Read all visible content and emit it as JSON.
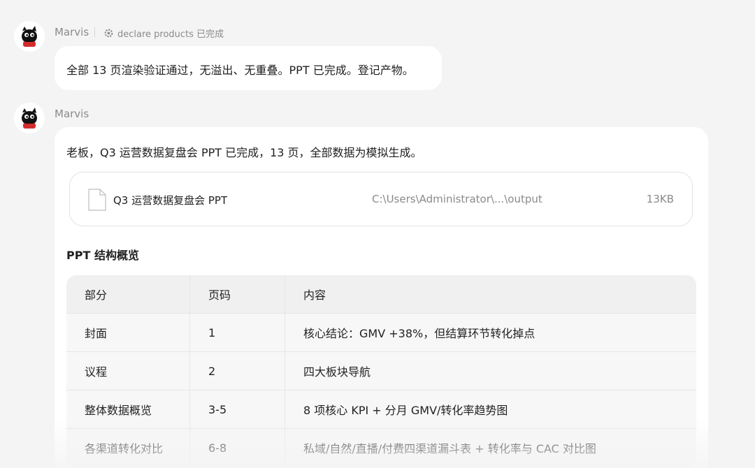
{
  "messages": [
    {
      "sender": "Marvis",
      "status": "declare products 已完成",
      "text": "全部 13 页渲染验证通过，无溢出、无重叠。PPT 已完成。登记产物。"
    },
    {
      "sender": "Marvis",
      "text": "老板，Q3 运营数据复盘会 PPT 已完成，13 页，全部数据为模拟生成。",
      "file": {
        "name": "Q3 运营数据复盘会 PPT",
        "path": "C:\\Users\\Administrator\\...\\output",
        "size": "13KB"
      },
      "section_title": "PPT 结构概览",
      "table": {
        "headers": [
          "部分",
          "页码",
          "内容"
        ],
        "rows": [
          [
            "封面",
            "1",
            "核心结论：GMV +38%，但结算环节转化掉点"
          ],
          [
            "议程",
            "2",
            "四大板块导航"
          ],
          [
            "整体数据概览",
            "3-5",
            "8 项核心 KPI + 分月 GMV/转化率趋势图"
          ],
          [
            "各渠道转化对比",
            "6-8",
            "私域/自然/直播/付费四渠道漏斗表 + 转化率与 CAC 对比图"
          ]
        ]
      }
    }
  ],
  "icons": {
    "avatar": "black-cat-mascot-icon",
    "status": "gear-icon",
    "file": "document-icon"
  }
}
